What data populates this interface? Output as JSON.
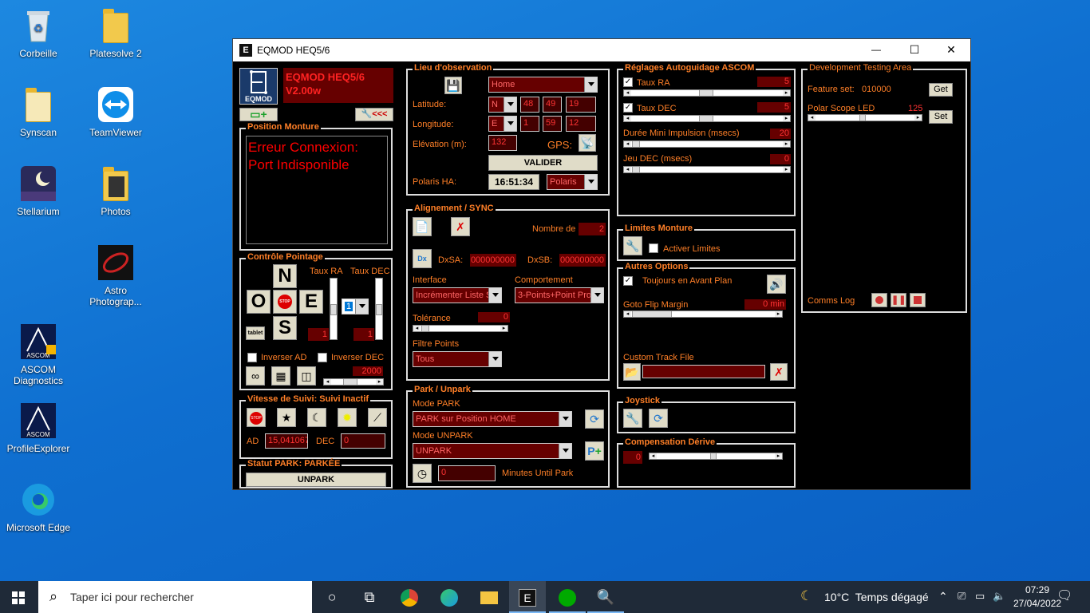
{
  "desktop": {
    "icons": [
      {
        "label": "Corbeille",
        "icon": "recycle-bin-icon"
      },
      {
        "label": "Platesolve 2",
        "icon": "folder-icon"
      },
      {
        "label": "Synscan",
        "icon": "folder-icon"
      },
      {
        "label": "TeamViewer",
        "icon": "teamviewer-icon"
      },
      {
        "label": "Stellarium",
        "icon": "stellarium-icon"
      },
      {
        "label": "Photos",
        "icon": "folder-icon"
      },
      {
        "label": "Astro Photograp...",
        "icon": "astrophotography-icon"
      },
      {
        "label": "ASCOM Diagnostics",
        "icon": "ascom-icon"
      },
      {
        "label": "ProfileExplorer",
        "icon": "ascom-icon"
      },
      {
        "label": "Microsoft Edge",
        "icon": "edge-icon"
      }
    ]
  },
  "window": {
    "title": "EQMOD HEQ5/6",
    "minimize": "—",
    "maximize": "☐",
    "close": "✕"
  },
  "header": {
    "logo": "EQMOD",
    "name": "EQMOD HEQ5/6",
    "version": "V2.00w",
    "wrench_label": "<<<"
  },
  "position": {
    "title": "Position Monture",
    "message": "Erreur Connexion: Port Indisponible"
  },
  "control": {
    "title": "Contrôle Pointage",
    "taux_ra": "Taux RA",
    "taux_dec": "Taux DEC",
    "n": "N",
    "s": "S",
    "o": "O",
    "e": "E",
    "stop": "STOP",
    "rate_select": "1",
    "tablet": "tablet",
    "ra_val": "1",
    "dec_val": "1",
    "inverser_ad": "Inverser AD",
    "inverser_dec": "Inverser DEC",
    "speed_val": "2000"
  },
  "tracking": {
    "title": "Vitesse de Suivi: Suivi Inactif",
    "ad_label": "AD",
    "ad_val": "15,041067",
    "dec_label": "DEC",
    "dec_val": "0"
  },
  "park_status": {
    "title": "Statut PARK: PARKÉE",
    "button": "UNPARK"
  },
  "site": {
    "title": "Lieu d'observation",
    "home": "Home",
    "lat_label": "Latitude:",
    "lat_dir": "N",
    "lat_d": "48",
    "lat_m": "49",
    "lat_s": "19",
    "lon_label": "Longitude:",
    "lon_dir": "E",
    "lon_d": "1",
    "lon_m": "59",
    "lon_s": "12",
    "elev_label": "Elévation (m):",
    "elev": "132",
    "gps_label": "GPS:",
    "valider": "VALIDER",
    "polaris_label": "Polaris HA:",
    "polaris_time": "16:51:34",
    "polaris_sel": "Polaris"
  },
  "align": {
    "title": "Alignement / SYNC",
    "nombre_label": "Nombre de",
    "nombre": "2",
    "dxsa_label": "DxSA:",
    "dxsa": "000000000",
    "dxsb_label": "DxSB:",
    "dxsb": "000000000",
    "interface_label": "Interface",
    "interface": "Incrémenter Liste S",
    "comportement_label": "Comportement",
    "comportement": "3-Points+Point Proc",
    "tolerance_label": "Tolérance",
    "tolerance": "0",
    "filtre_label": "Filtre Points",
    "filtre": "Tous"
  },
  "park": {
    "title": "Park / Unpark",
    "mode_park_label": "Mode PARK",
    "mode_park": "PARK sur Position HOME",
    "mode_unpark_label": "Mode UNPARK",
    "mode_unpark": "UNPARK",
    "minutes": "0",
    "minutes_label": "Minutes Until Park"
  },
  "guide": {
    "title": "Réglages Autoguidage ASCOM",
    "taux_ra": "Taux RA",
    "taux_ra_val": "5",
    "taux_ra_pos": 0.5,
    "taux_dec": "Taux DEC",
    "taux_dec_val": "5",
    "taux_dec_pos": 0.5,
    "duree": "Durée Mini Impulsion (msecs)",
    "duree_val": "20",
    "jeu": "Jeu DEC (msecs)",
    "jeu_val": "0"
  },
  "limits": {
    "title": "Limites Monture",
    "activer": "Activer Limites"
  },
  "options": {
    "title": "Autres Options",
    "toujours": "Toujours en Avant Plan",
    "flip_label": "Goto Flip Margin",
    "flip_val": "0 min",
    "track_label": "Custom Track File"
  },
  "joystick": {
    "title": "Joystick"
  },
  "drift": {
    "title": "Compensation Dérive",
    "val": "0"
  },
  "dev": {
    "title": "Development Testing Area",
    "feature_label": "Feature set:",
    "feature_val": "010000",
    "get": "Get",
    "led_label": "Polar Scope LED",
    "led_val": "125",
    "set": "Set",
    "comms_label": "Comms Log"
  },
  "taskbar": {
    "search_placeholder": "Taper ici pour rechercher",
    "weather": "10°C  Temps dégagé",
    "time": "07:29",
    "date": "27/04/2022"
  }
}
